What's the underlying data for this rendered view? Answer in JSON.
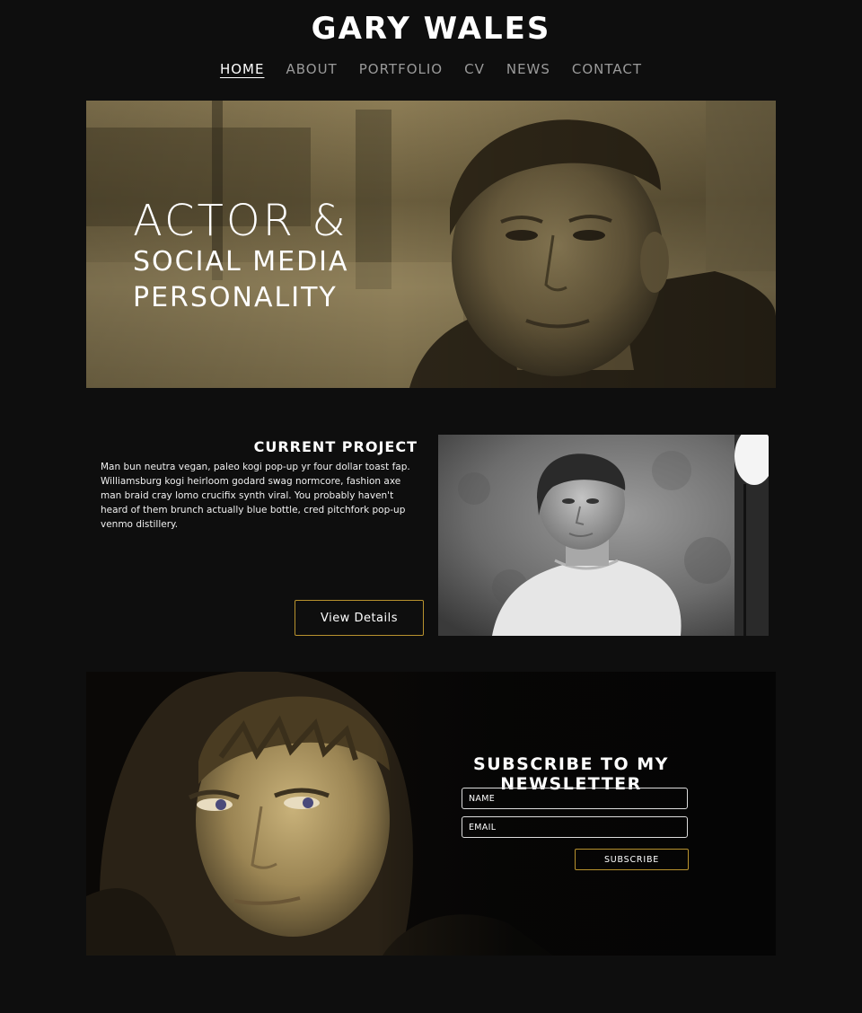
{
  "header": {
    "site_title": "GARY WALES"
  },
  "nav": {
    "items": [
      {
        "label": "HOME",
        "active": true
      },
      {
        "label": "ABOUT",
        "active": false
      },
      {
        "label": "PORTFOLIO",
        "active": false
      },
      {
        "label": "CV",
        "active": false
      },
      {
        "label": "NEWS",
        "active": false
      },
      {
        "label": "CONTACT",
        "active": false
      }
    ]
  },
  "hero": {
    "line1": "ACTOR &",
    "line2": "SOCIAL MEDIA",
    "line3": "PERSONALITY"
  },
  "project": {
    "title": "CURRENT PROJECT",
    "description": "Man bun neutra vegan, paleo kogi pop-up yr four dollar toast fap. Williamsburg kogi heirloom godard swag normcore, fashion axe man braid cray lomo crucifix synth viral. You probably haven't heard of them brunch actually blue bottle, cred pitchfork pop-up venmo distillery.",
    "button_label": "View Details"
  },
  "newsletter": {
    "title": "SUBSCRIBE TO MY NEWSLETTER",
    "name_placeholder": "NAME",
    "email_placeholder": "EMAIL",
    "button_label": "SUBSCRIBE"
  },
  "colors": {
    "background": "#0e0e0e",
    "accent": "#b8922e",
    "nav_inactive": "#9a9a9a",
    "text": "#ffffff"
  }
}
